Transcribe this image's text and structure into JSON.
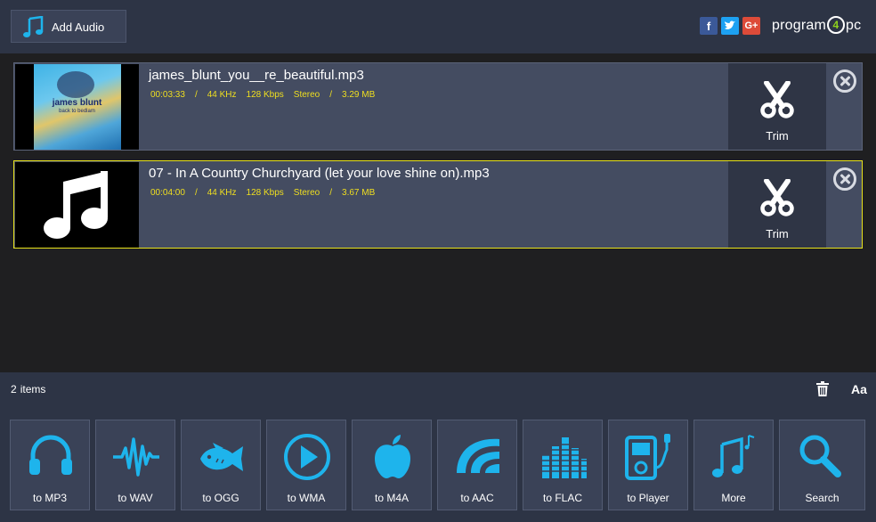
{
  "header": {
    "add_audio_label": "Add Audio",
    "brand_pre": "program",
    "brand_num": "4",
    "brand_post": "pc",
    "accent_color": "#1eb4ec"
  },
  "files": [
    {
      "name": "james_blunt_you__re_beautiful.mp3",
      "cover_title": "james blunt",
      "cover_subtitle": "back to bedlam",
      "duration": "00:03:33",
      "sample_rate": "44 KHz",
      "bitrate": "128 Kbps",
      "channels": "Stereo",
      "size": "3.29 MB",
      "trim_label": "Trim"
    },
    {
      "name": "07 - In A Country Churchyard (let your love shine on).mp3",
      "duration": "00:04:00",
      "sample_rate": "44 KHz",
      "bitrate": "128 Kbps",
      "channels": "Stereo",
      "size": "3.67 MB",
      "trim_label": "Trim"
    }
  ],
  "status": {
    "count": "2",
    "items_label": "items",
    "font_label": "Aa"
  },
  "formats": [
    {
      "label": "to MP3"
    },
    {
      "label": "to WAV"
    },
    {
      "label": "to OGG"
    },
    {
      "label": "to WMA"
    },
    {
      "label": "to M4A"
    },
    {
      "label": "to AAC"
    },
    {
      "label": "to FLAC"
    },
    {
      "label": "to Player"
    },
    {
      "label": "More"
    },
    {
      "label": "Search"
    }
  ]
}
